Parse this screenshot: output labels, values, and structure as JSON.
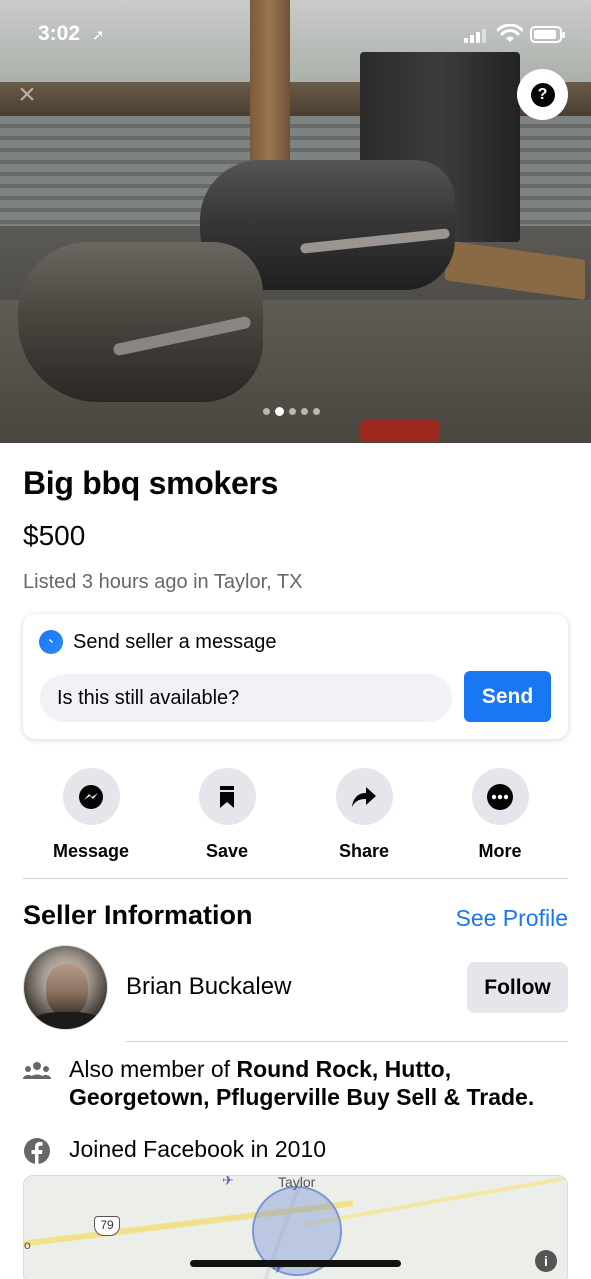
{
  "status_bar": {
    "time": "3:02",
    "location_glyph": "➚"
  },
  "photo": {
    "close_glyph": "×",
    "help_glyph": "?",
    "carousel_count": 5,
    "carousel_active_index": 1
  },
  "listing": {
    "title": "Big bbq smokers",
    "price": "$500",
    "meta": "Listed 3 hours ago in Taylor, TX"
  },
  "message_card": {
    "heading": "Send seller a message",
    "input_value": "Is this still available?",
    "send_label": "Send"
  },
  "actions": [
    {
      "label": "Message",
      "icon": "messenger-icon"
    },
    {
      "label": "Save",
      "icon": "bookmark-icon"
    },
    {
      "label": "Share",
      "icon": "share-arrow-icon"
    },
    {
      "label": "More",
      "icon": "more-dots-icon"
    }
  ],
  "seller": {
    "section_title": "Seller Information",
    "see_profile": "See Profile",
    "name": "Brian Buckalew",
    "follow_label": "Follow",
    "groups_prefix": "Also member of ",
    "groups_bold": "Round Rock, Hutto, Georgetown, Pflugerville Buy Sell & Trade.",
    "joined": "Joined Facebook in 2010"
  },
  "map": {
    "city_label": "Taylor",
    "route_shield": "79",
    "info_glyph": "i",
    "edge_label": "o"
  },
  "colors": {
    "accent": "#1877f2",
    "secondary_text": "#65676b",
    "button_gray": "#e4e6eb"
  }
}
